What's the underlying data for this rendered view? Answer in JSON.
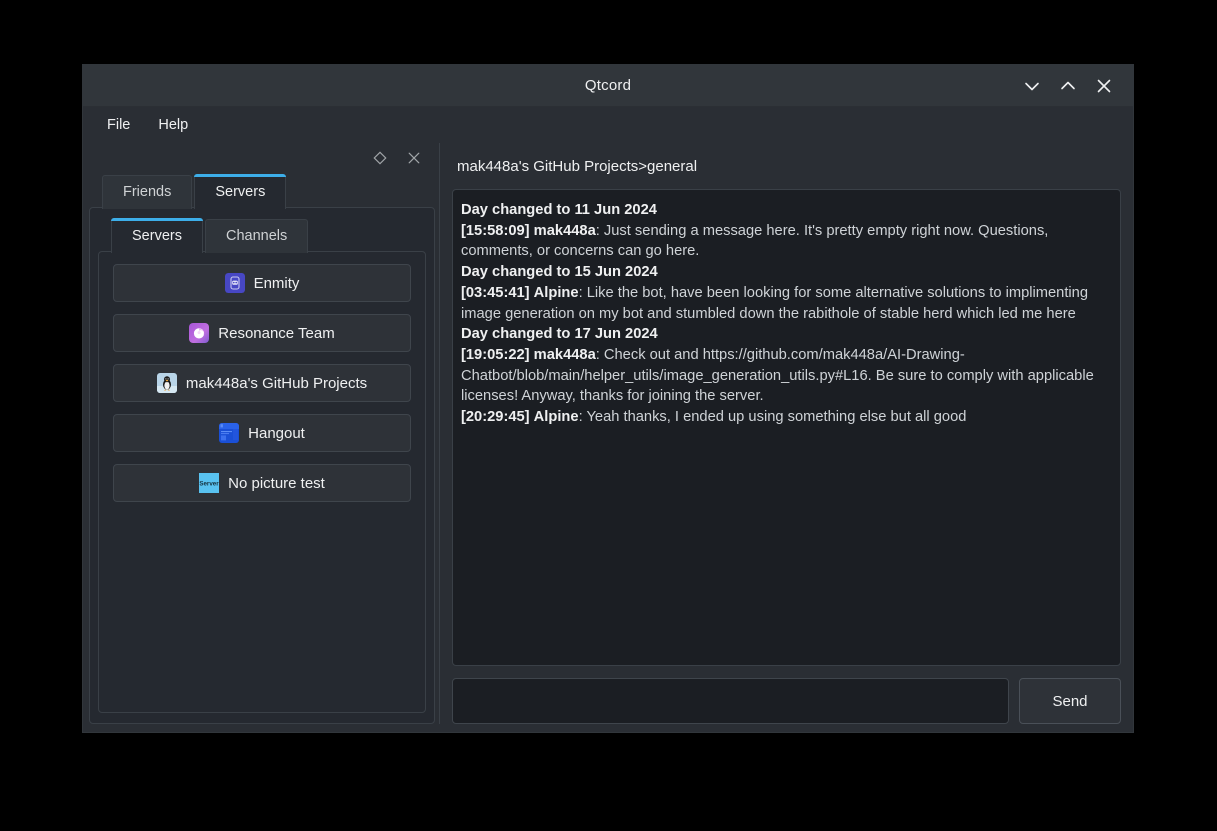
{
  "window": {
    "title": "Qtcord",
    "controls": [
      {
        "name": "minimize",
        "glyph": "chevron-down"
      },
      {
        "name": "maximize",
        "glyph": "chevron-up"
      },
      {
        "name": "close",
        "glyph": "x"
      }
    ]
  },
  "menubar": {
    "items": [
      {
        "label": "File"
      },
      {
        "label": "Help"
      }
    ]
  },
  "dock": {
    "float_icon": "diamond-icon",
    "close_icon": "close-icon"
  },
  "outer_tabs": {
    "items": [
      {
        "label": "Friends",
        "active": false
      },
      {
        "label": "Servers",
        "active": true
      }
    ]
  },
  "inner_tabs": {
    "items": [
      {
        "label": "Servers",
        "active": true
      },
      {
        "label": "Channels",
        "active": false
      }
    ]
  },
  "servers": [
    {
      "label": "Enmity",
      "icon": "enmity-server-icon"
    },
    {
      "label": "Resonance Team",
      "icon": "resonance-team-server-icon"
    },
    {
      "label": "mak448a's GitHub Projects",
      "icon": "penguin-server-icon"
    },
    {
      "label": "Hangout",
      "icon": "hangout-server-icon"
    },
    {
      "label": "No picture test",
      "icon": "server-placeholder-icon"
    }
  ],
  "chat": {
    "header": "mak448a's GitHub Projects>general",
    "messages": [
      {
        "type": "daychange",
        "text": "Day changed to 11 Jun 2024"
      },
      {
        "type": "message",
        "stamp": "[15:58:09]",
        "author": "mak448a",
        "text": ": Just sending a message here. It's pretty empty right now. Questions, comments, or concerns can go here."
      },
      {
        "type": "daychange",
        "text": "Day changed to 15 Jun 2024"
      },
      {
        "type": "message",
        "stamp": "[03:45:41]",
        "author": "Alpine",
        "text": ": Like the bot, have been looking for some alternative solutions to implimenting image generation on my bot and stumbled down the rabithole of stable herd which led me here"
      },
      {
        "type": "daychange",
        "text": "Day changed to 17 Jun 2024"
      },
      {
        "type": "message",
        "stamp": "[19:05:22]",
        "author": "mak448a",
        "text": ": Check out and https://github.com/mak448a/AI-Drawing-Chatbot/blob/main/helper_utils/image_generation_utils.py#L16. Be sure to comply with applicable licenses! Anyway, thanks for joining the server."
      },
      {
        "type": "message",
        "stamp": "[20:29:45]",
        "author": "Alpine",
        "text": ": Yeah thanks, I ended up using something else but all good"
      }
    ]
  },
  "composer": {
    "input_value": "",
    "input_placeholder": "",
    "send_label": "Send"
  },
  "colors": {
    "accent": "#3daee9",
    "window_bg": "#2a2e34",
    "titlebar_bg": "#31363b",
    "panel_bg": "#252930",
    "message_bg": "#1b1e23",
    "text": "#eff0f1"
  }
}
